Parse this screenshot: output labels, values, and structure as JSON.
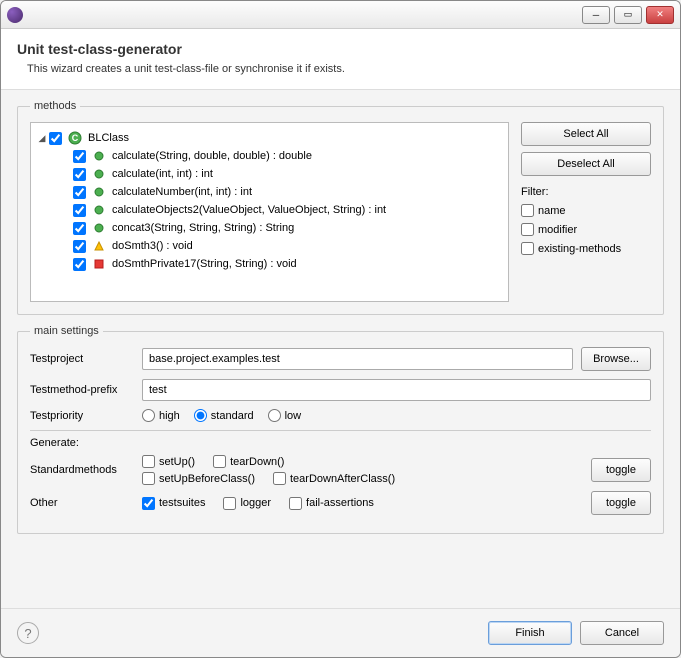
{
  "header": {
    "title": "Unit test-class-generator",
    "subtitle": "This wizard creates a unit test-class-file or synchronise it if exists."
  },
  "methods": {
    "legend": "methods",
    "root": {
      "label": "BLClass",
      "checked": true
    },
    "items": [
      {
        "label": "calculate(String, double, double) : double",
        "checked": true,
        "icon": "green-dot"
      },
      {
        "label": "calculate(int, int) : int",
        "checked": true,
        "icon": "green-dot"
      },
      {
        "label": "calculateNumber(int, int) : int",
        "checked": true,
        "icon": "green-dot"
      },
      {
        "label": "calculateObjects2(ValueObject, ValueObject, String) : int",
        "checked": true,
        "icon": "green-dot"
      },
      {
        "label": "concat3(String, String, String) : String",
        "checked": true,
        "icon": "green-dot"
      },
      {
        "label": "doSmth3() : void",
        "checked": true,
        "icon": "yellow-tri"
      },
      {
        "label": "doSmthPrivate17(String, String) : void",
        "checked": true,
        "icon": "red-sq"
      }
    ],
    "buttons": {
      "selectAll": "Select All",
      "deselectAll": "Deselect All"
    },
    "filter": {
      "label": "Filter:",
      "name": "name",
      "nameChecked": false,
      "modifier": "modifier",
      "modifierChecked": false,
      "existing": "existing-methods",
      "existingChecked": false
    }
  },
  "settings": {
    "legend": "main settings",
    "testproject": {
      "label": "Testproject",
      "value": "base.project.examples.test",
      "browse": "Browse..."
    },
    "prefix": {
      "label": "Testmethod-prefix",
      "value": "test"
    },
    "priority": {
      "label": "Testpriority",
      "options": {
        "high": "high",
        "standard": "standard",
        "low": "low"
      },
      "selected": "standard"
    },
    "generateLabel": "Generate:",
    "standard": {
      "label": "Standardmethods",
      "setUp": "setUp()",
      "setUpChecked": false,
      "tearDown": "tearDown()",
      "tearDownChecked": false,
      "setUpBefore": "setUpBeforeClass()",
      "setUpBeforeChecked": false,
      "tearDownAfter": "tearDownAfterClass()",
      "tearDownAfterChecked": false,
      "toggle": "toggle"
    },
    "other": {
      "label": "Other",
      "testsuites": "testsuites",
      "testsuitesChecked": true,
      "logger": "logger",
      "loggerChecked": false,
      "failAssertions": "fail-assertions",
      "failAssertionsChecked": false,
      "toggle": "toggle"
    }
  },
  "footer": {
    "finish": "Finish",
    "cancel": "Cancel"
  }
}
